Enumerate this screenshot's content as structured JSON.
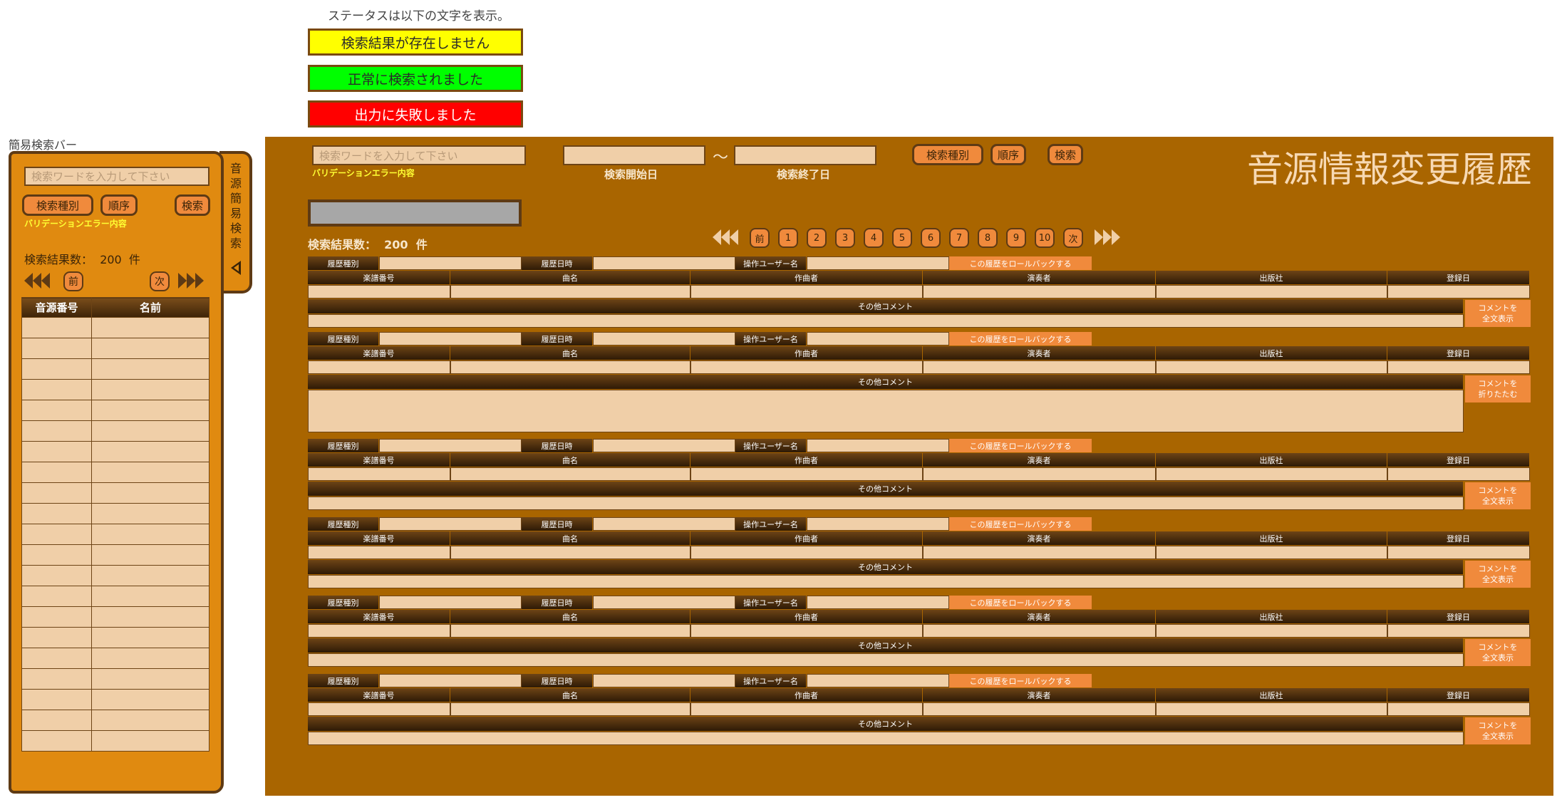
{
  "status_note": "ステータスは以下の文字を表示。",
  "statuses": [
    "検索結果が存在しません",
    "正常に検索されました",
    "出力に失敗しました"
  ],
  "sidebar": {
    "caption": "簡易検索バー",
    "search_placeholder": "検索ワードを入力して下さい",
    "btn_type": "検索種別",
    "btn_order": "順序",
    "btn_search": "検索",
    "validation": "バリデーションエラー内容",
    "count_label": "検索結果数：",
    "count_value": "200",
    "count_unit": "件",
    "prev": "前",
    "next": "次",
    "col_id": "音源番号",
    "col_name": "名前",
    "tab_label": [
      "音",
      "源",
      "簡",
      "易",
      "検",
      "索"
    ]
  },
  "main": {
    "title": "音源情報変更履歴",
    "search_placeholder": "検索ワードを入力して下さい",
    "validation": "バリデーションエラー内容",
    "date_start": "検索開始日",
    "date_end": "検索終了日",
    "tilde": "～",
    "btn_type": "検索種別",
    "btn_order": "順序",
    "btn_search": "検索",
    "count_label": "検索結果数：",
    "count_value": "200",
    "count_unit": "件",
    "pages": [
      "前",
      "1",
      "2",
      "3",
      "4",
      "5",
      "6",
      "7",
      "8",
      "9",
      "10",
      "次"
    ]
  },
  "record": {
    "history_type": "履歴種別",
    "history_date": "履歴日時",
    "operator": "操作ユーザー名",
    "rollback": "この履歴をロールバックする",
    "cols": [
      "楽譜番号",
      "曲名",
      "作曲者",
      "演奏者",
      "出版社",
      "登録日"
    ],
    "comment": "その他コメント",
    "expand": "コメントを\n全文表示",
    "collapse": "コメントを\n折りたたむ"
  }
}
